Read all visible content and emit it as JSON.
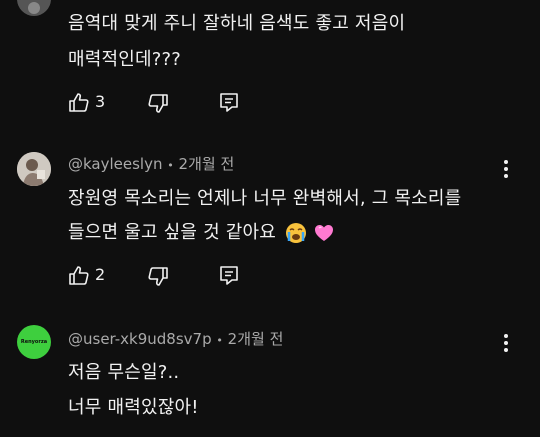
{
  "comments": [
    {
      "author": "",
      "time": "",
      "lines": [
        "음역대 맞게 주니 잘하네 음색도 좋고 저음이",
        "매력적인데???"
      ],
      "likes": "3",
      "avatar_icon": "user-avatar-icon"
    },
    {
      "author": "@kayleeslyn",
      "time": "2개월 전",
      "lines": [
        "장원영 목소리는 언제나 너무 완벽해서, 그 목소리를",
        "들으면 울고 싶을 것 같아요"
      ],
      "emojis": [
        "loudly-crying-face-icon",
        "pink-heart-icon"
      ],
      "likes": "2",
      "avatar_icon": "user-avatar-icon"
    },
    {
      "author": "@user-xk9ud8sv7p",
      "time": "2개월 전",
      "lines": [
        "저음 무슨일?..",
        "너무 매력있잖아!"
      ],
      "likes": "",
      "avatar_text": "Renyorza",
      "avatar_color": "#3ecf3e"
    }
  ],
  "separator": "•",
  "colors": {
    "background": "#0f0f0f",
    "text": "#f1f1f1",
    "meta": "#aaaaaa"
  }
}
